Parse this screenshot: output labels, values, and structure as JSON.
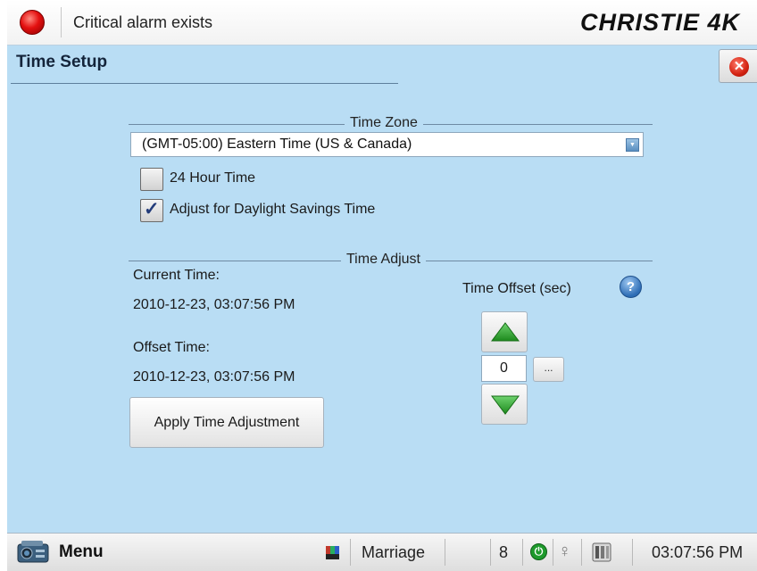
{
  "status_bar": {
    "alarm_text": "Critical alarm exists",
    "logo_text": "CHRISTIE 4K"
  },
  "page": {
    "title": "Time Setup",
    "close_icon": "close-icon"
  },
  "time_zone": {
    "legend": "Time Zone",
    "selected": "(GMT-05:00) Eastern Time (US & Canada)",
    "hour24": {
      "label": "24 Hour Time",
      "checked": false
    },
    "dst": {
      "label": "Adjust for Daylight Savings Time",
      "checked": true
    }
  },
  "time_adjust": {
    "legend": "Time Adjust",
    "current_label": "Current Time:",
    "current_value": "2010-12-23, 03:07:56 PM",
    "offset_label": "Offset Time:",
    "offset_value": "2010-12-23, 03:07:56 PM",
    "offset_title": "Time Offset (sec)",
    "offset_field": "0",
    "ellipsis": "...",
    "help_glyph": "?",
    "apply_label": "Apply Time Adjustment"
  },
  "bottom_bar": {
    "menu_label": "Menu",
    "input_label": "Marriage",
    "channel": "8",
    "time": "03:07:56 PM"
  },
  "colors": {
    "panel_bg": "#b9ddf4",
    "alarm_red": "#e41010",
    "arrow_green": "#2fa62f",
    "power_green": "#1e9a2c"
  }
}
